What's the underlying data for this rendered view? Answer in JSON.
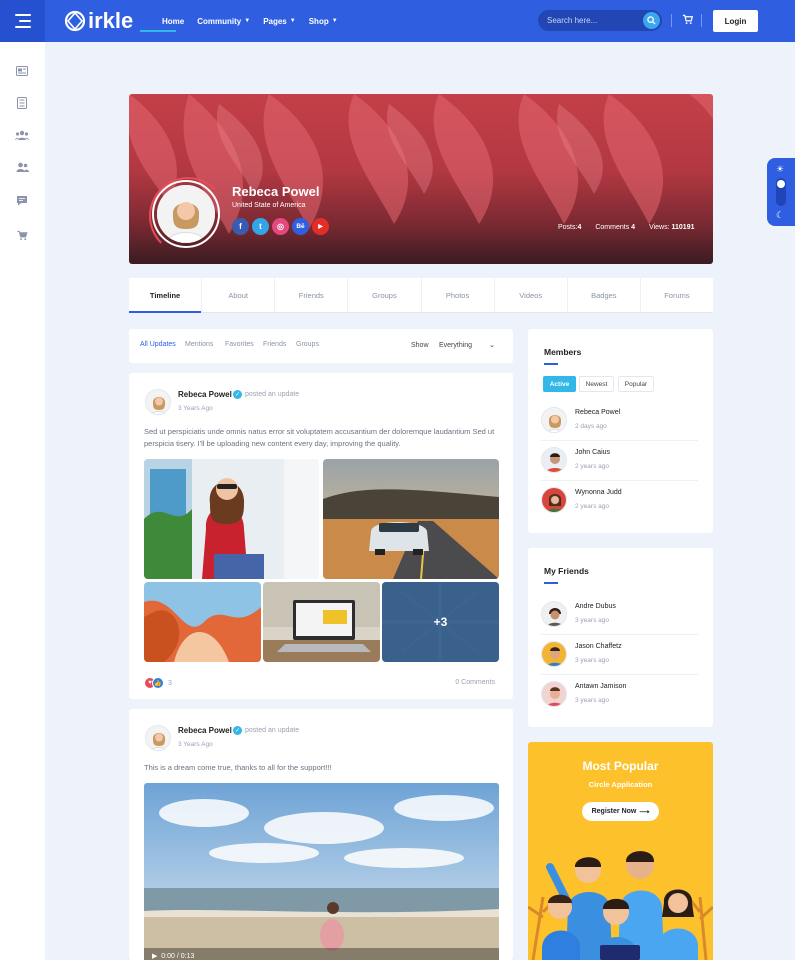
{
  "brand": {
    "name": "irkle"
  },
  "nav": {
    "items": [
      "Home",
      "Community",
      "Pages",
      "Shop"
    ]
  },
  "search": {
    "placeholder": "Search here..."
  },
  "auth": {
    "login_label": "Login"
  },
  "sidebar": {
    "icons": [
      "newsfeed-icon",
      "document-icon",
      "groups-icon",
      "users-icon",
      "chat-icon",
      "cart-icon"
    ]
  },
  "profile": {
    "name": "Rebeca Powel",
    "location": "United State of America",
    "stats": {
      "posts_label": "Posts:",
      "posts": "4",
      "comments_label": "Comments",
      "comments": "4",
      "views_label": "Views:",
      "views": "110191"
    },
    "socials": [
      {
        "icon": "facebook-icon",
        "glyph": "f",
        "color": "#3b5bb0"
      },
      {
        "icon": "twitter-icon",
        "glyph": "t",
        "color": "#33a4e8"
      },
      {
        "icon": "dribbble-icon",
        "glyph": "◎",
        "color": "#e5477f"
      },
      {
        "icon": "behance-icon",
        "glyph": "Bē",
        "color": "#2f5fe0"
      },
      {
        "icon": "youtube-icon",
        "glyph": "▶",
        "color": "#e52d27"
      }
    ]
  },
  "tabs": [
    "Timeline",
    "About",
    "Friends",
    "Groups",
    "Photos",
    "Videos",
    "Badges",
    "Forums"
  ],
  "feed_filter": {
    "tabs": [
      "All Updates",
      "Mentions",
      "Favorites",
      "Friends",
      "Groups"
    ],
    "show_label": "Show",
    "show_value": "Everything"
  },
  "posts": [
    {
      "author": "Rebeca Powel",
      "action": "posted an update",
      "time": "3 Years Ago",
      "text": "Sed ut perspiciatis unde omnis natus error sit voluptatem accusantium der doloremque laudantium Sed ut perspicia tisery. I'll be uploading new content every day, improving the quality.",
      "more_photos": "+3",
      "reactions": "3",
      "comments": "0 Comments"
    },
    {
      "author": "Rebeca Powel",
      "action": "posted an update",
      "time": "3 Years Ago",
      "text": "This is a dream come true, thanks to all for the support!!!",
      "video_time": "0:00 / 0:13"
    }
  ],
  "members": {
    "title": "Members",
    "tabs": [
      "Active",
      "Newest",
      "Popular"
    ],
    "list": [
      {
        "name": "Rebeca Powel",
        "time": "2 days ago"
      },
      {
        "name": "John Caius",
        "time": "2 years ago"
      },
      {
        "name": "Wynonna Judd",
        "time": "2 years ago"
      }
    ]
  },
  "friends": {
    "title": "My Friends",
    "list": [
      {
        "name": "Andre Dubus",
        "time": "3 years ago"
      },
      {
        "name": "Jason Chaffetz",
        "time": "3 years ago"
      },
      {
        "name": "Antawn Jamison",
        "time": "3 years ago"
      }
    ]
  },
  "promo": {
    "title": "Most Popular",
    "subtitle": "Circle Application",
    "button": "Register Now"
  },
  "colors": {
    "primary": "#2f5fe0",
    "accent": "#33b6e8",
    "promo": "#fdc22b"
  }
}
